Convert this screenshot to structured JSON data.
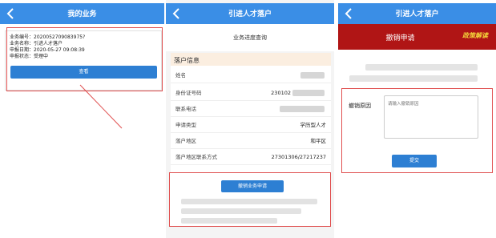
{
  "panel1": {
    "title": "我的业务",
    "lines": [
      "业务编号：2020052709083975?",
      "业务名称：引进人才落户",
      "申报日期：2020-05-27 09:08:39",
      "申报状态：受理中"
    ],
    "view_button": "查看"
  },
  "panel2": {
    "title": "引进人才落户",
    "page_heading": "业务进度查询",
    "section_title": "落户信息",
    "rows": [
      {
        "label": "姓名",
        "value": ""
      },
      {
        "label": "身份证号码",
        "value": "230102"
      },
      {
        "label": "联系电话",
        "value": ""
      },
      {
        "label": "申请类型",
        "value": "学历型人才"
      },
      {
        "label": "落户地区",
        "value": "和平区"
      },
      {
        "label": "落户地区联系方式",
        "value": "27301306/27217237"
      }
    ],
    "cancel_button": "撤销业务申请"
  },
  "panel3": {
    "title": "引进人才落户",
    "banner_title": "撤销申请",
    "banner_brand": "政策解读",
    "reason_label": "撤销原因",
    "reason_placeholder": "请输入撤销原因",
    "submit_button": "提交"
  },
  "colors": {
    "nav": "#3a8ee6",
    "button": "#2d7fd3",
    "highlight": "#e05050",
    "banner": "#b01515"
  }
}
